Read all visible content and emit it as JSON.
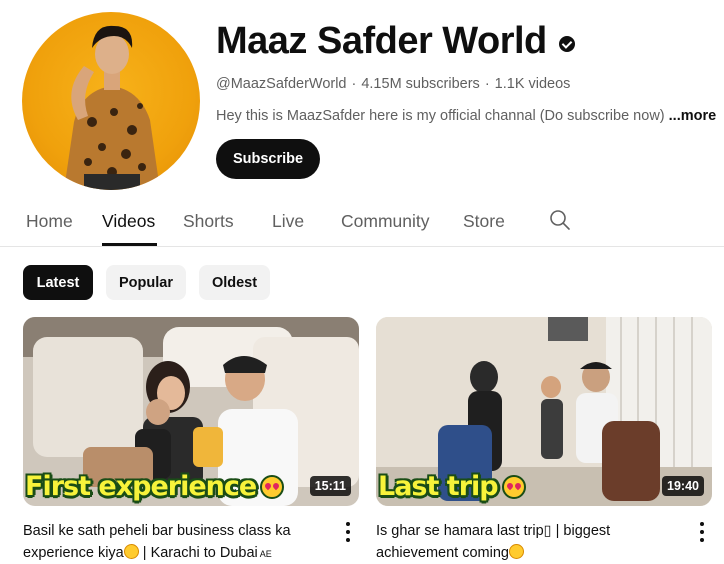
{
  "channel": {
    "name": "Maaz Safder World",
    "handle": "@MaazSafderWorld",
    "subscribers": "4.15M subscribers",
    "videos_count": "1.1K videos",
    "description": "Hey this is MaazSafder here is my official channal (Do subscribe now)",
    "more_label": "...more",
    "subscribe_label": "Subscribe",
    "verified_icon": "check-circle-icon"
  },
  "tabs": [
    {
      "label": "Home"
    },
    {
      "label": "Videos",
      "active": true
    },
    {
      "label": "Shorts"
    },
    {
      "label": "Live"
    },
    {
      "label": "Community"
    },
    {
      "label": "Store"
    }
  ],
  "search_icon": "search-icon",
  "chips": [
    {
      "label": "Latest",
      "active": true
    },
    {
      "label": "Popular"
    },
    {
      "label": "Oldest"
    }
  ],
  "videos": [
    {
      "title": "Basil ke sath peheli bar business class ka experience kiya",
      "title_suffix": " | Karachi to Dubai",
      "title_flag": "AE",
      "duration": "15:11",
      "overlay_text": "First experience"
    },
    {
      "title": "Is ghar se hamara last trip▯ | biggest achievement coming",
      "duration": "19:40",
      "overlay_text": "Last trip"
    }
  ],
  "colors": {
    "text_primary": "#0f0f0f",
    "text_secondary": "#606060",
    "chip_bg": "#f2f2f2",
    "overlay_yellow": "#f7f33a"
  }
}
